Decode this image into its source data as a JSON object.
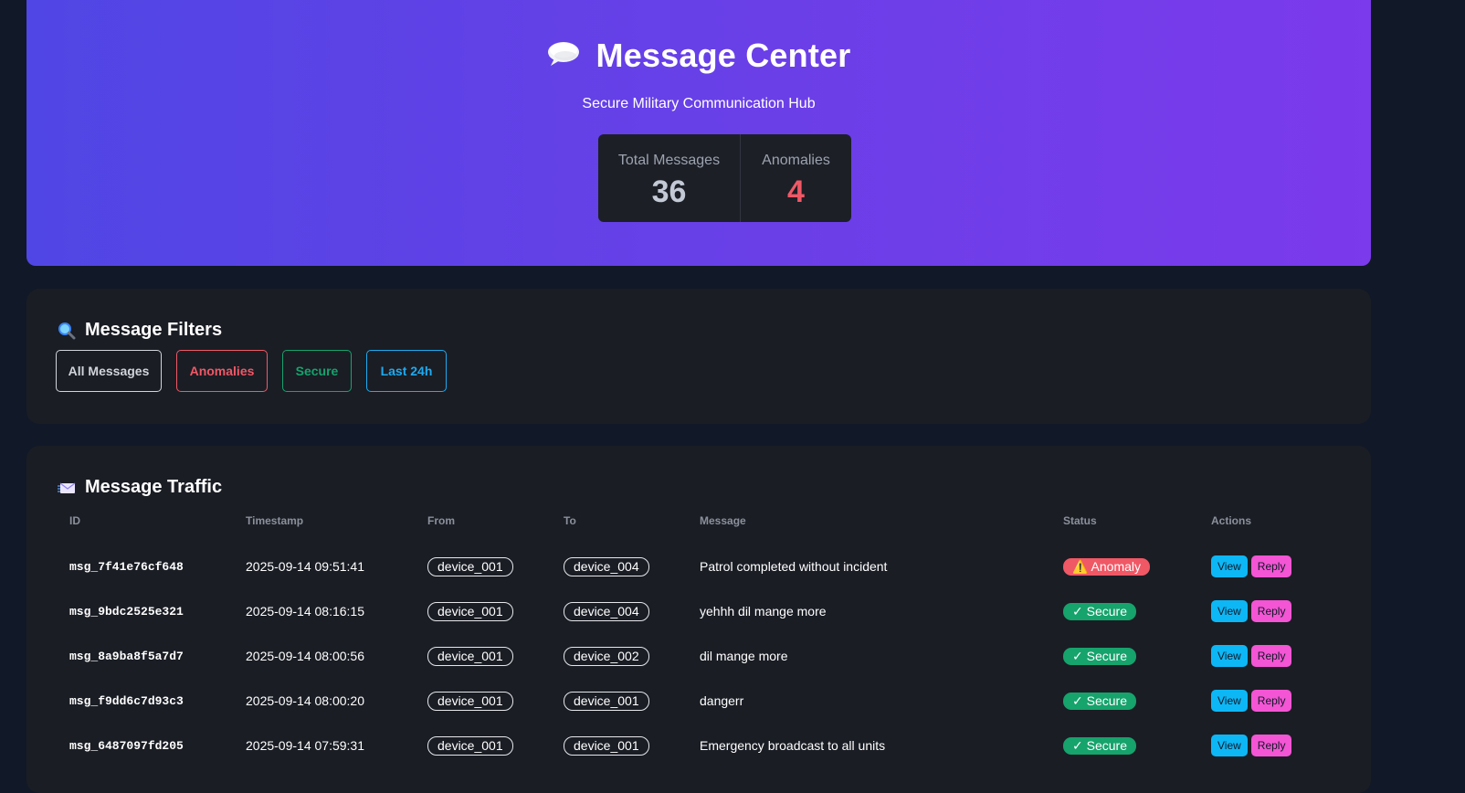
{
  "header": {
    "title": "Message Center",
    "subtitle": "Secure Military Communication Hub",
    "icon": "speech-bubble-icon",
    "stats": [
      {
        "label": "Total Messages",
        "value": "36"
      },
      {
        "label": "Anomalies",
        "value": "4"
      }
    ]
  },
  "filters": {
    "title": "Message Filters",
    "icon": "magnifier-icon",
    "buttons": [
      "All Messages",
      "Anomalies",
      "Secure",
      "Last 24h"
    ]
  },
  "traffic": {
    "title": "Message Traffic",
    "icon": "envelope-icon",
    "columns": [
      "ID",
      "Timestamp",
      "From",
      "To",
      "Message",
      "Status",
      "Actions"
    ],
    "view_label": "View",
    "reply_label": "Reply",
    "rows": [
      {
        "id": "msg_7f41e76cf648",
        "timestamp": "2025-09-14 09:51:41",
        "from": "device_001",
        "to": "device_004",
        "message": "Patrol completed without incident",
        "status": "⚠️ Anomaly"
      },
      {
        "id": "msg_9bdc2525e321",
        "timestamp": "2025-09-14 08:16:15",
        "from": "device_001",
        "to": "device_004",
        "message": "yehhh dil mange more",
        "status": "✓ Secure"
      },
      {
        "id": "msg_8a9ba8f5a7d7",
        "timestamp": "2025-09-14 08:00:56",
        "from": "device_001",
        "to": "device_002",
        "message": "dil mange more",
        "status": "✓ Secure"
      },
      {
        "id": "msg_f9dd6c7d93c3",
        "timestamp": "2025-09-14 08:00:20",
        "from": "device_001",
        "to": "device_001",
        "message": "dangerr",
        "status": "✓ Secure"
      },
      {
        "id": "msg_6487097fd205",
        "timestamp": "2025-09-14 07:59:31",
        "from": "device_001",
        "to": "device_001",
        "message": "Emergency broadcast to all units",
        "status": "✓ Secure"
      }
    ],
    "colors": {
      "anomaly": "#f05866",
      "secure": "#16a36c",
      "view": "#0db7f5",
      "reply": "#f355d4"
    }
  }
}
